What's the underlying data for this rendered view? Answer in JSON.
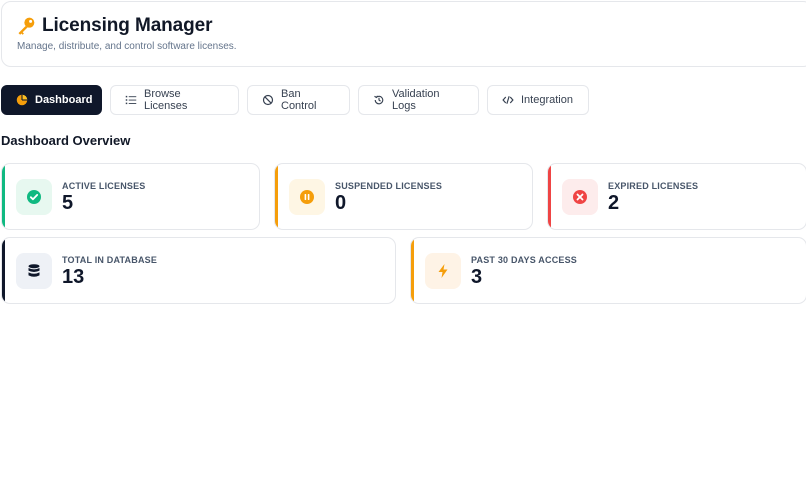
{
  "header": {
    "title": "Licensing Manager",
    "subtitle": "Manage, distribute, and control software licenses.",
    "icon": "key-icon"
  },
  "tabs": [
    {
      "label": "Dashboard",
      "icon": "pie-chart-icon",
      "active": true
    },
    {
      "label": "Browse Licenses",
      "icon": "list-icon",
      "active": false
    },
    {
      "label": "Ban Control",
      "icon": "ban-icon",
      "active": false
    },
    {
      "label": "Validation Logs",
      "icon": "history-icon",
      "active": false
    },
    {
      "label": "Integration",
      "icon": "code-icon",
      "active": false
    }
  ],
  "overview": {
    "title": "Dashboard Overview",
    "cards": [
      {
        "label": "ACTIVE LICENSES",
        "value": "5",
        "icon": "check-circle-icon",
        "accent": "#10b981"
      },
      {
        "label": "SUSPENDED LICENSES",
        "value": "0",
        "icon": "pause-circle-icon",
        "accent": "#f59e0b"
      },
      {
        "label": "EXPIRED LICENSES",
        "value": "2",
        "icon": "x-circle-icon",
        "accent": "#ef4444"
      },
      {
        "label": "TOTAL IN DATABASE",
        "value": "13",
        "icon": "database-icon",
        "accent": "#0f172a"
      },
      {
        "label": "PAST 30 DAYS ACCESS",
        "value": "3",
        "icon": "bolt-icon",
        "accent": "#f59e0b"
      }
    ]
  }
}
